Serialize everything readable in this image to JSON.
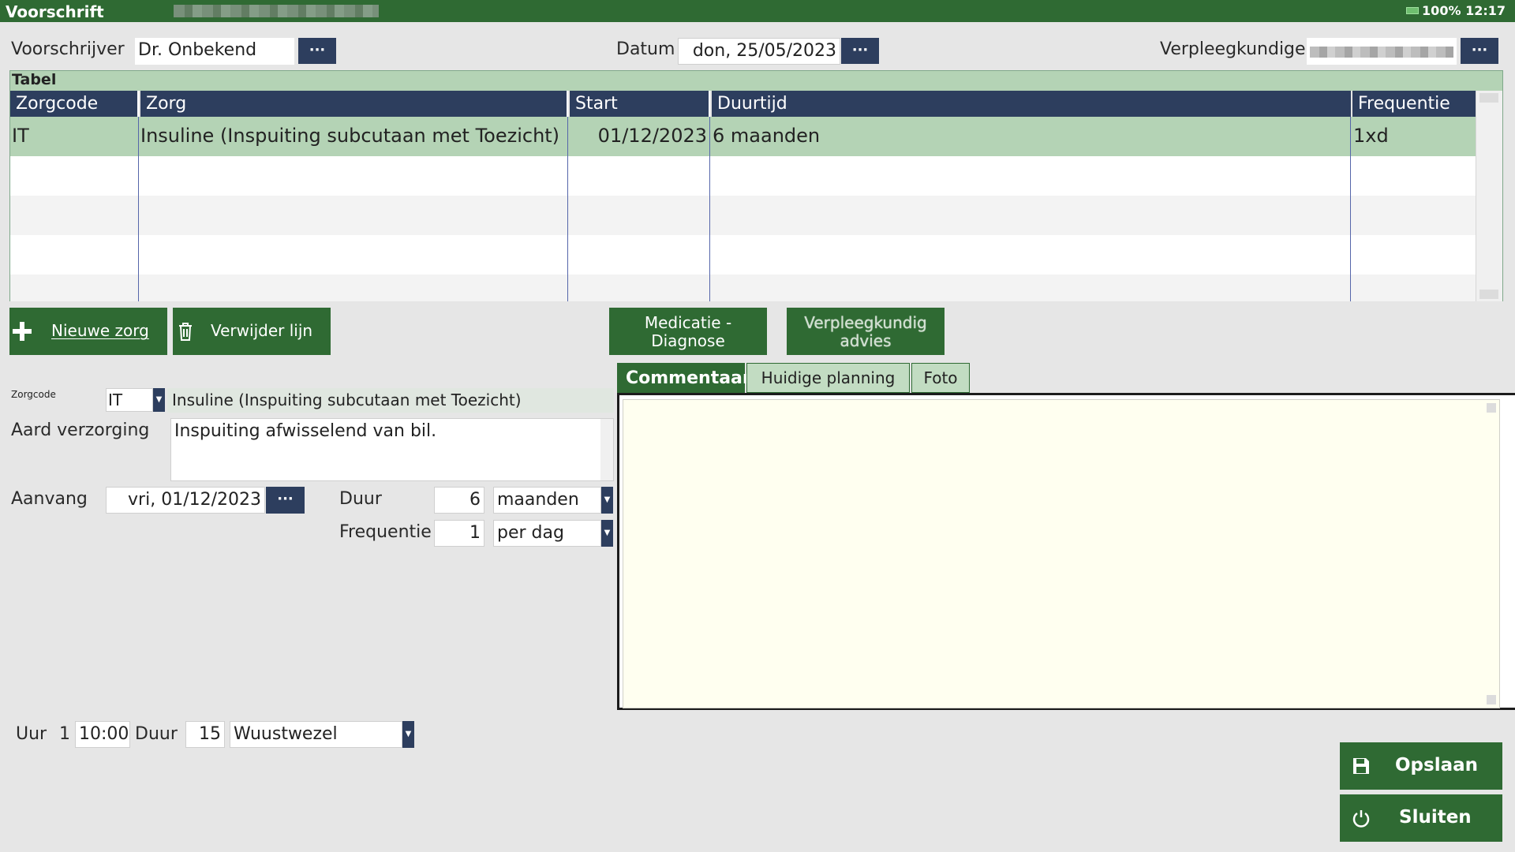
{
  "window": {
    "title": "Voorschrift",
    "battery": "100%",
    "time": "12:17"
  },
  "header": {
    "voorschrijver_label": "Voorschrijver",
    "voorschrijver_value": "Dr. Onbekend",
    "datum_label": "Datum",
    "datum_value": "don, 25/05/2023",
    "verpleegkundige_label": "Verpleegkundige",
    "dots": "···"
  },
  "table": {
    "caption": "Tabel",
    "columns": [
      "Zorgcode",
      "Zorg",
      "Start",
      "Duurtijd",
      "Frequentie"
    ],
    "rows": [
      {
        "zorgcode": "IT",
        "zorg": "Insuline (Inspuiting subcutaan met Toezicht)",
        "start": "01/12/2023",
        "duurtijd": "6 maanden",
        "frequentie": "1xd"
      }
    ]
  },
  "buttons": {
    "nieuwe_zorg": "Nieuwe zorg",
    "verwijder_lijn": "Verwijder lijn",
    "medicatie_line1": "Medicatie -",
    "medicatie_line2": "Diagnose",
    "verpleegkundig_line1": "Verpleegkundig",
    "verpleegkundig_line2": "advies",
    "opslaan": "Opslaan",
    "sluiten": "Sluiten"
  },
  "form": {
    "zorgcode_label": "Zorgcode",
    "zorgcode_value": "IT",
    "zorg_omschrijving": "Insuline (Inspuiting subcutaan met Toezicht)",
    "aard_label": "Aard verzorging",
    "aard_value": "Inspuiting afwisselend van bil.",
    "aanvang_label": "Aanvang",
    "aanvang_value": "vri, 01/12/2023",
    "duur_label": "Duur",
    "duur_value": "6",
    "duur_unit": "maanden",
    "frequentie_label": "Frequentie",
    "frequentie_value": "1",
    "frequentie_unit": "per dag"
  },
  "tabs": [
    "Commentaar",
    "Huidige planning",
    "Foto"
  ],
  "planning": {
    "uur_label": "Uur",
    "uur_index": "1",
    "uur_value": "10:00",
    "duur_label": "Duur",
    "duur_value": "15",
    "locatie": "Wuustwezel"
  }
}
